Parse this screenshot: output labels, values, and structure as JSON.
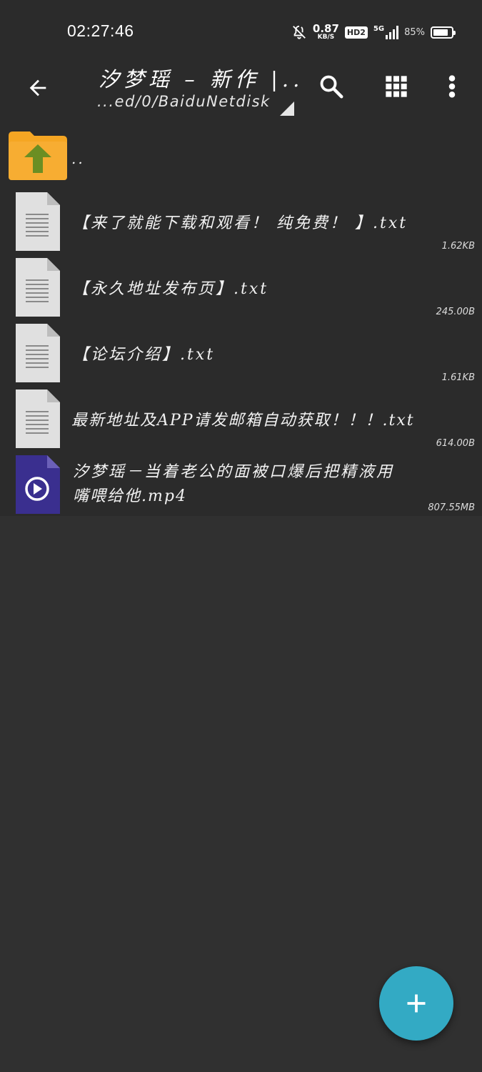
{
  "status_bar": {
    "time": "02:27:46",
    "net_speed": "0.87",
    "net_speed_unit": "KB/S",
    "hd_badge": "HD2",
    "signal_label": "5G",
    "battery_percent": "85%",
    "battery_level": 0.85
  },
  "app_bar": {
    "title": "汐梦瑶 – 新作 |...",
    "path": "...ed/0/BaiduNetdisk",
    "back_icon": "arrow-back-icon",
    "search_icon": "search-icon",
    "grid_icon": "grid-view-icon",
    "more_icon": "more-vert-icon"
  },
  "files": [
    {
      "name": "..",
      "icon": "folder-up-icon",
      "size": ""
    },
    {
      "name": "【来了就能下载和观看！ 纯免费！ 】.txt",
      "icon": "text-file-icon",
      "size": "1.62KB"
    },
    {
      "name": "【永久地址发布页】.txt",
      "icon": "text-file-icon",
      "size": "245.00B"
    },
    {
      "name": "【论坛介绍】.txt",
      "icon": "text-file-icon",
      "size": "1.61KB"
    },
    {
      "name": "最新地址及APP请发邮箱自动获取！！！.txt",
      "icon": "text-file-icon",
      "size": "614.00B"
    },
    {
      "name_line1": "汐梦瑶－当着老公的面被口爆后把精液用",
      "name_line2": "嘴喂给他.mp4",
      "icon": "video-file-icon",
      "size": "807.55MB"
    }
  ],
  "fab": {
    "label": "+",
    "icon": "add-icon"
  },
  "colors": {
    "background": "#303030",
    "bar": "#2b2b2b",
    "fab": "#33aac4",
    "folder": "#f5a623",
    "folder_arrow": "#6b8e23",
    "text_file": "#e0e0e0",
    "video_file": "#3a2f8f"
  }
}
